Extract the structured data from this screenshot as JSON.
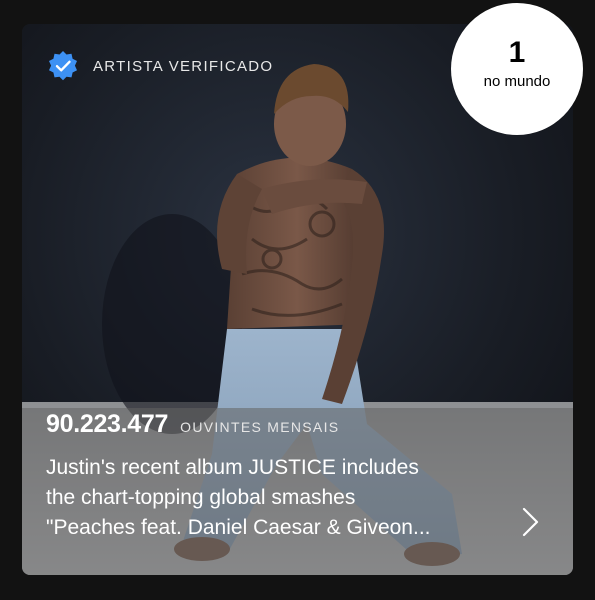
{
  "artist": {
    "verified_label": "ARTISTA VERIFICADO",
    "rank": {
      "number": "1",
      "label": "no mundo"
    },
    "monthly_listeners": {
      "count": "90.223.477",
      "label": "OUVINTES MENSAIS"
    },
    "bio": "Justin's recent album JUSTICE includes\nthe chart-topping global smashes\n\"Peaches feat. Daniel Caesar & Giveon..."
  },
  "colors": {
    "verified_badge": "#3d91f4",
    "panel_overlay": "#626262",
    "background": "#121212"
  },
  "icons": {
    "verified": "verified-badge-icon",
    "chevron": "chevron-right-icon"
  }
}
